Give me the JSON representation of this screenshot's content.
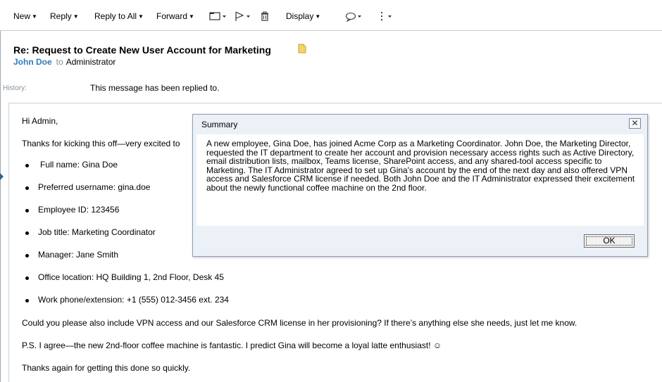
{
  "toolbar": {
    "new": "New",
    "reply": "Reply",
    "reply_all": "Reply to All",
    "forward": "Forward",
    "display": "Display"
  },
  "message": {
    "subject": "Re: Request to Create New User Account for Marketing",
    "sender": "John Doe",
    "to_word": "to",
    "recipient": "Administrator",
    "history_label": "History:",
    "history_text": "This message has been replied to.",
    "greeting": "Hi Admin,",
    "intro": "Thanks for kicking this off—very excited to",
    "details": [
      "Full name: Gina Doe",
      "Preferred username: gina.doe",
      "Employee ID: 123456",
      "Job title: Marketing Coordinator",
      "Manager: Jane Smith",
      "Office location: HQ Building 1, 2nd Floor, Desk 45",
      "Work phone/extension: +1 (555) 012-3456 ext. 234"
    ],
    "request": "Could you please also include VPN access and our Salesforce CRM license in her provisioning? If there’s anything else she needs, just let me know.",
    "ps": "P.S. I agree—the new 2nd-floor coffee machine is fantastic. I predict Gina will become a loyal latte enthusiast! ☺",
    "closing": "Thanks again for getting this done so quickly."
  },
  "dialog": {
    "title": "Summary",
    "close_glyph": "✕",
    "text": "A new employee, Gina Doe, has joined Acme Corp as a Marketing Coordinator. John Doe, the Marketing Director, requested the IT department to create her account and provision necessary access rights such as Active Directory, email distribution lists, mailbox, Teams license, SharePoint access, and any shared-tool access specific to Marketing. The IT Administrator agreed to set up Gina's account by the end of the next day and also offered VPN access and Salesforce CRM license if needed. Both John Doe and the IT Administrator expressed their excitement about the newly functional coffee machine on the 2nd floor.",
    "ok_label": "OK"
  },
  "icons": {
    "folder": "folder-icon",
    "flag": "flag-icon",
    "trash": "trash-icon",
    "bubble": "speech-bubble-icon",
    "more": "more-vertical-icon",
    "note": "note-icon"
  },
  "colors": {
    "sender": "#2f7cbf",
    "dialog_bg": "#ecf1f8",
    "note": "#f2c94c"
  }
}
